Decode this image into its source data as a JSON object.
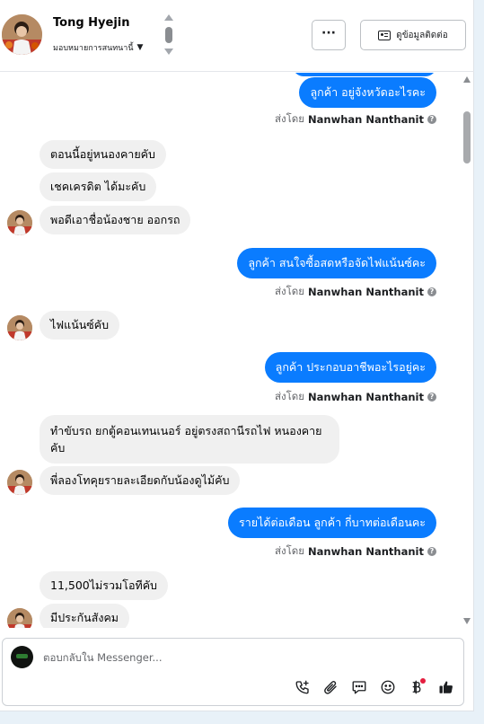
{
  "header": {
    "name": "Tong Hyejin",
    "assign": "มอบหมายการสนทนานี้",
    "more": "···",
    "contact": "ดูข้อมูลติดต่อ"
  },
  "messages": [
    {
      "kind": "out",
      "text": "ลูกค้า อยู่จังหวัดอะไรคะ"
    },
    {
      "kind": "sent",
      "prefix": "ส่งโดย",
      "agent": "Nanwhan Nanthanit"
    },
    {
      "kind": "in",
      "text": "ตอนนี้อยู่หนองคายคับ"
    },
    {
      "kind": "in",
      "text": "เชคเครดิต ได้มะคับ"
    },
    {
      "kind": "in",
      "text": "พอดีเอาชื่อน้องชาย ออกรถ"
    },
    {
      "kind": "out",
      "text": "ลูกค้า สนใจซื้อสดหรือจัดไฟแน้นซ์คะ"
    },
    {
      "kind": "sent",
      "prefix": "ส่งโดย",
      "agent": "Nanwhan Nanthanit"
    },
    {
      "kind": "in",
      "text": "ไฟแน้นซ์คับ"
    },
    {
      "kind": "out",
      "text": "ลูกค้า ประกอบอาชีพอะไรอยู่คะ"
    },
    {
      "kind": "sent",
      "prefix": "ส่งโดย",
      "agent": "Nanwhan Nanthanit"
    },
    {
      "kind": "in",
      "text": "ทำขับรถ ยกตู้คอนเทนเนอร์ อยู่ตรงสถานีรถไฟ หนองคายคับ"
    },
    {
      "kind": "in",
      "text": "พี่ลองโทคุยรายละเอียดกับน้องดูไม้คับ"
    },
    {
      "kind": "out",
      "text": "รายได้ต่อเดือน ลูกค้า กี่บาทต่อเดือนคะ"
    },
    {
      "kind": "sent",
      "prefix": "ส่งโดย",
      "agent": "Nanwhan Nanthanit"
    },
    {
      "kind": "in",
      "text": "11,500ไม่รวมโอทีคับ"
    },
    {
      "kind": "in",
      "text": "มีประกันสังคม"
    }
  ],
  "help_icon": "?",
  "composer": {
    "placeholder": "ตอบกลับใน Messenger...",
    "tools": [
      "phone-plus-icon",
      "paperclip-icon",
      "chat-icon",
      "smiley-icon",
      "baht-icon",
      "thumbs-up-icon"
    ]
  },
  "colors": {
    "accent": "#0a7cff",
    "incoming_bubble": "#f0f0f0",
    "badge": "#e41e3f"
  }
}
